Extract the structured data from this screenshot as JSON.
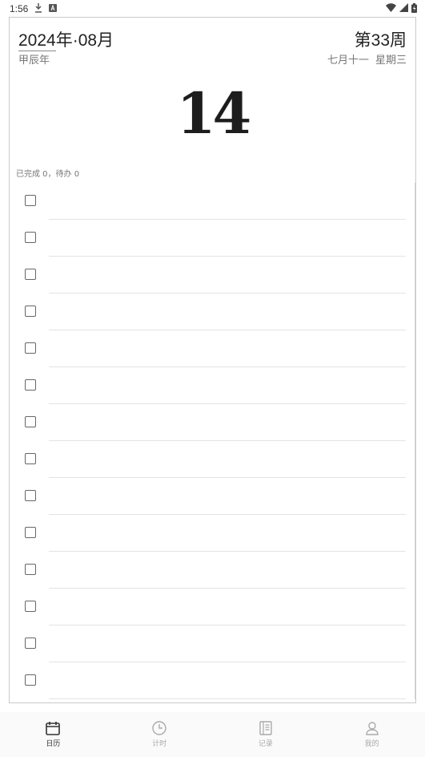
{
  "status_bar": {
    "time": "1:56",
    "icons": [
      "download-icon",
      "notification-a-icon",
      "wifi-icon",
      "signal-icon",
      "battery-icon"
    ]
  },
  "header": {
    "year": "2024",
    "year_suffix": "年",
    "separator": "·",
    "month": "08月",
    "week": "第33周",
    "ganzhi_year": "甲辰年",
    "lunar_date": "七月十一",
    "weekday": "星期三"
  },
  "day": "14",
  "summary": "已完成 0，待办 0",
  "tasks": {
    "row_count": 14
  },
  "nav": {
    "items": [
      {
        "label": "日历",
        "icon": "calendar-icon",
        "active": true
      },
      {
        "label": "计时",
        "icon": "clock-icon",
        "active": false
      },
      {
        "label": "记录",
        "icon": "notebook-icon",
        "active": false
      },
      {
        "label": "我的",
        "icon": "person-icon",
        "active": false
      }
    ]
  },
  "colors": {
    "border": "#c9c9c9",
    "text_primary": "#222222",
    "text_secondary": "#777777",
    "nav_inactive": "#aaaaaa",
    "nav_active": "#333333"
  }
}
